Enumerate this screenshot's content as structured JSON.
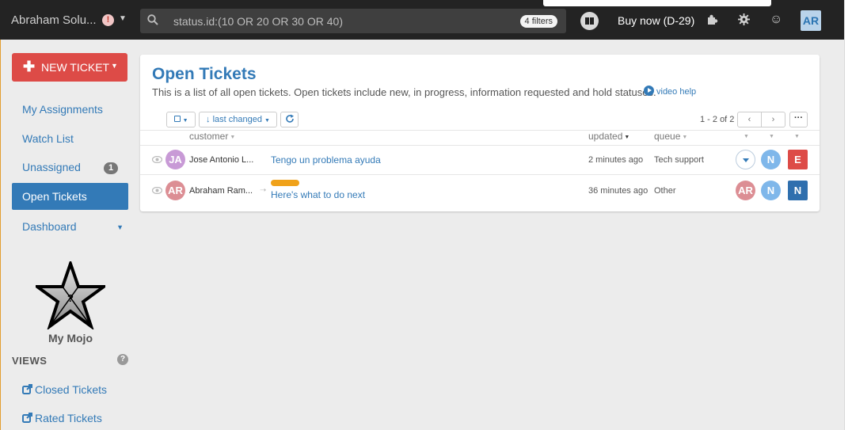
{
  "topbar": {
    "company_name": "Abraham Solu...",
    "alert_glyph": "!",
    "search_value": "status.id:(10 OR 20 OR 30 OR 40)",
    "filters_badge": "4 filters",
    "buy_now": "Buy now (D-29)",
    "user_initials": "AR"
  },
  "sidebar": {
    "new_ticket_label": "NEW TICKET",
    "items": [
      {
        "label": "My Assignments"
      },
      {
        "label": "Watch List"
      },
      {
        "label": "Unassigned",
        "count": "1"
      },
      {
        "label": "Open Tickets",
        "active": true
      },
      {
        "label": "Dashboard"
      }
    ],
    "mojo_label": "My Mojo",
    "mojo_glyph": "?",
    "views_heading": "VIEWS",
    "views_help": "?",
    "views": [
      {
        "label": "Closed Tickets"
      },
      {
        "label": "Rated Tickets"
      }
    ]
  },
  "main": {
    "title": "Open Tickets",
    "description": "This is a list of all open tickets. Open tickets include new, in progress, information requested and hold statuses.",
    "video_help": "video help",
    "sort_label": "last changed",
    "sort_arrow": "↓",
    "pager": "1 - 2 of 2",
    "more_glyph": "···",
    "columns": {
      "customer": "customer",
      "updated": "updated",
      "queue": "queue"
    },
    "rows": [
      {
        "initials": "JA",
        "customer": "Jose Antonio L...",
        "subject": "Tengo un problema ayuda",
        "updated": "2 minutes ago",
        "queue": "Tech support",
        "agent": "N",
        "priority": "E",
        "avatar_color": "#c89ad6",
        "priority_color": "#dd4b47"
      },
      {
        "initials": "AR",
        "customer": "Abraham Ram...",
        "subject": "Here's what to do next",
        "updated": "36 minutes ago",
        "queue": "Other",
        "status_initials": "AR",
        "agent": "N",
        "priority": "N",
        "avatar_color": "#dc8e94",
        "priority_color": "#2f6fae",
        "has_tag": true
      }
    ]
  },
  "colors": {
    "topbar": "#232323",
    "link_blue": "#337ab7",
    "new_ticket_red": "#dd4b47",
    "tag_orange": "#f0a21a",
    "agent_blue": "#7fb7ea"
  }
}
